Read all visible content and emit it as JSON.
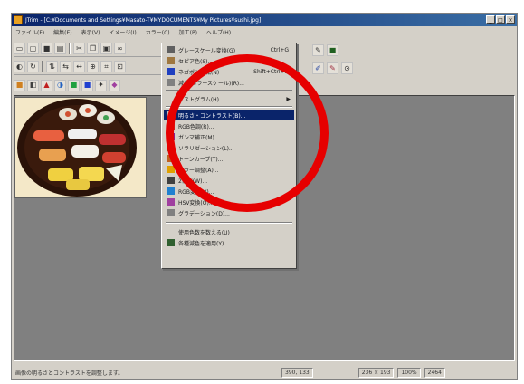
{
  "window": {
    "title": "JTrim - [C:¥Documents and Settings¥Masato-T¥MYDOCUMENTS¥My Pictures¥sushi.jpg]",
    "controls": [
      "_",
      "□",
      "×"
    ]
  },
  "menubar": {
    "items": [
      "ファイル(F)",
      "編集(E)",
      "表示(V)",
      "イメージ(I)",
      "カラー(C)",
      "加工(P)",
      "ヘルプ(H)"
    ]
  },
  "dropdown": {
    "items": [
      {
        "label": "グレースケール変換(G)",
        "shortcut": "Ctrl+G",
        "icon_color": "#606060"
      },
      {
        "label": "セピア色(S)...",
        "shortcut": "",
        "icon_color": "#a07840"
      },
      {
        "label": "ネガポジ反転(N)",
        "shortcut": "Shift+Ctrl+N",
        "icon_color": "#2040c0"
      },
      {
        "label": "減色(カラースケール)(R)...",
        "shortcut": "",
        "icon_color": "#808080"
      },
      {
        "label": "ヒストグラム(H)",
        "shortcut": "",
        "icon_color": "",
        "submenu": true
      },
      {
        "label": "明るさ・コントラスト(B)...",
        "shortcut": "",
        "icon_color": "#404040",
        "selected": true
      },
      {
        "label": "RGB色調(R)...",
        "shortcut": "",
        "icon_color": "#d02020"
      },
      {
        "label": "ガンマ補正(M)...",
        "shortcut": "",
        "icon_color": "#8020a0"
      },
      {
        "label": "ソラリゼーション(L)...",
        "shortcut": "",
        "icon_color": "#30a030"
      },
      {
        "label": "トーンカーブ(T)...",
        "shortcut": "",
        "icon_color": "#c06020"
      },
      {
        "label": "カラー調整(A)...",
        "shortcut": "",
        "icon_color": "#e0a000"
      },
      {
        "label": "2値化(W)...",
        "shortcut": "",
        "icon_color": "#404040"
      },
      {
        "label": "RGB変換(V)...",
        "shortcut": "",
        "icon_color": "#2080d0"
      },
      {
        "label": "HSV変換(O)...",
        "shortcut": "",
        "icon_color": "#a040a0"
      },
      {
        "label": "グラデーション(D)...",
        "shortcut": "",
        "icon_color": "#808080"
      },
      {
        "label": "使用色数を数える(U)",
        "shortcut": "",
        "icon_color": ""
      },
      {
        "label": "各種減色を適用(Y)...",
        "shortcut": "",
        "icon_color": "#306030"
      }
    ]
  },
  "toolbar": {
    "row1_icons": [
      "new-icon",
      "open-icon",
      "save-icon",
      "print-icon",
      "cut-icon",
      "copy-icon",
      "paste-icon",
      "binoculars-icon"
    ],
    "row2_icons": [
      "grayscale-icon",
      "rotate-icon",
      "flip-icon",
      "mirror-icon",
      "arrow-icon",
      "zoom-icon",
      "crop-icon",
      "resize-icon"
    ],
    "row3_icons": [
      "color-icon",
      "brightness-icon",
      "red-icon",
      "contrast-icon",
      "green-icon",
      "blue-icon",
      "magic-icon",
      "palette-icon"
    ],
    "right_icons": [
      "eyedropper-icon",
      "layer-icon",
      "pen-icon",
      "brush-icon",
      "stamp-icon"
    ]
  },
  "statusbar": {
    "message": "画像の明るさとコントラストを調整します。",
    "coords": "390, 133",
    "size": "236 × 193",
    "zoom": "100%",
    "memory": "2464"
  },
  "colors": {
    "accent_red": "#e60000",
    "selection": "#0a246a",
    "canvas_gray": "#808080"
  }
}
